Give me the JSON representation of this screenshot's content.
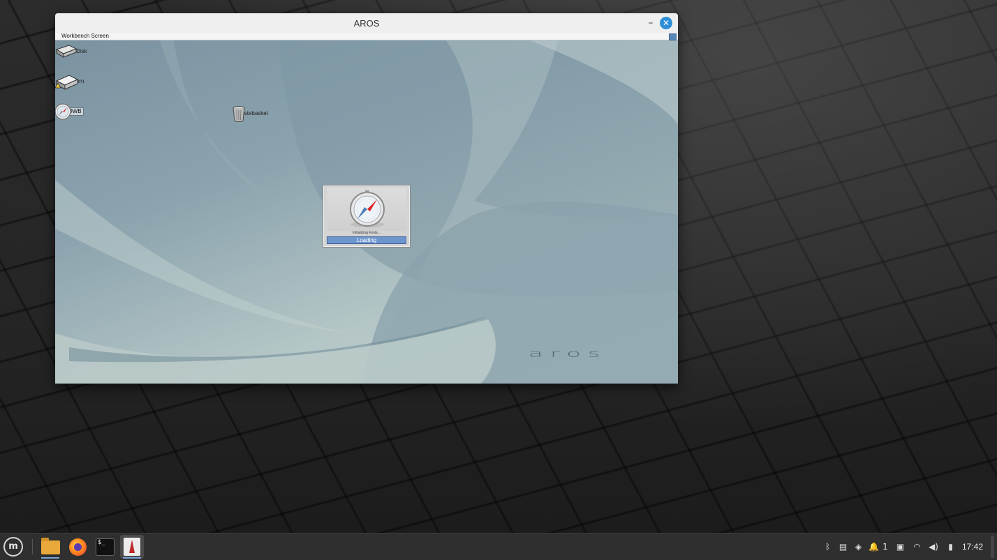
{
  "window": {
    "title": "AROS",
    "minimize_glyph": "–",
    "close_glyph": "✕"
  },
  "workbench": {
    "screen_label": "Workbench Screen",
    "icons": [
      {
        "label": "RAM Disk",
        "icon": "ram-disk-icon"
      },
      {
        "label": "System",
        "icon": "system-disk-icon"
      },
      {
        "label": "OWB",
        "icon": "owb-icon"
      },
      {
        "label": "Wastebasket",
        "icon": "wastebasket-icon"
      }
    ],
    "logo_text": "aros"
  },
  "splash": {
    "status_text": "Initializing Fonts...",
    "progress_label": "Loading",
    "progress": 1.0
  },
  "taskbar": {
    "menu_icon": "mint-menu-icon",
    "menu_glyph": "m",
    "apps": [
      {
        "name": "files",
        "icon": "folder-icon"
      },
      {
        "name": "firefox",
        "icon": "firefox-icon"
      },
      {
        "name": "terminal",
        "icon": "terminal-icon",
        "glyph": "$_"
      },
      {
        "name": "aros",
        "icon": "aros-icon"
      }
    ],
    "tray": {
      "bluetooth": "ᛒ",
      "clipboard": "▤",
      "shield": "◈",
      "notifications_glyph": "🔔",
      "notifications_count": "1",
      "document": "▣",
      "wifi": "◠",
      "volume": "◀)",
      "battery": "▮"
    },
    "clock": "17:42"
  },
  "colors": {
    "accent": "#2e8fd6",
    "progress": "#5f88c2",
    "taskbar": "#2f2f2f"
  }
}
